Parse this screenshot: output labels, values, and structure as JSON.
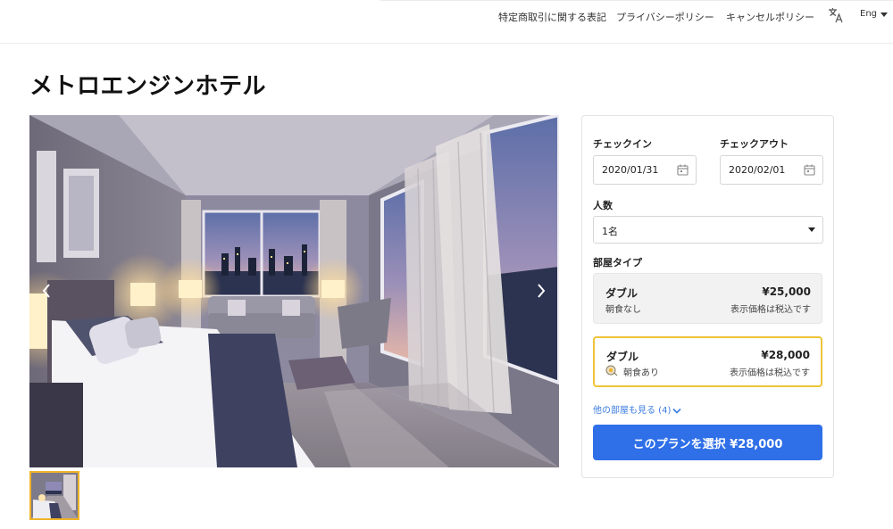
{
  "header": {
    "nav": [
      "特定商取引に関する表記",
      "プライバシーポリシー",
      "キャンセルポリシー"
    ],
    "language_icon": "translate-icon",
    "language": "Eng"
  },
  "hotel": {
    "name": "メトロエンジンホテル"
  },
  "gallery": {
    "prev_icon": "chevron-left-icon",
    "next_icon": "chevron-right-icon",
    "selected_thumbnail": 1
  },
  "booking": {
    "checkin_label": "チェックイン",
    "checkin_value": "2020/01/31",
    "checkout_label": "チェックアウト",
    "checkout_value": "2020/02/01",
    "guests_label": "人数",
    "guests_value": "1名",
    "room_type_label": "部屋タイプ",
    "rooms": [
      {
        "name": "ダブル",
        "price": "¥25,000",
        "meal": "朝食なし",
        "note": "表示価格は税込です",
        "selected": false
      },
      {
        "name": "ダブル",
        "price": "¥28,000",
        "meal": "朝食あり",
        "note": "表示価格は税込です",
        "selected": true
      }
    ],
    "more_rooms": "他の部屋も見る (4)",
    "cta": "このプランを選択 ¥28,000"
  },
  "colors": {
    "accent": "#2f6fe8",
    "selected_border": "#f0c43a",
    "link": "#3b7be0"
  }
}
